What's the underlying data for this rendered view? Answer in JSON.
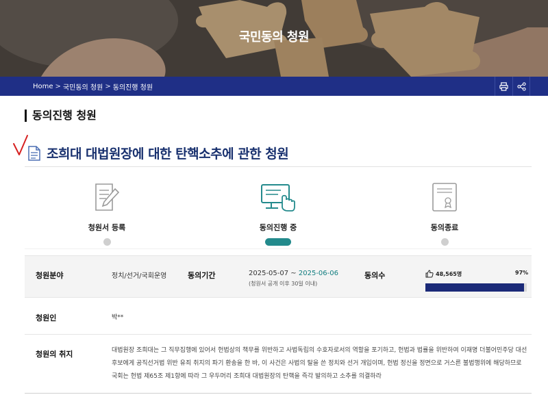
{
  "header": {
    "title": "국민동의 청원"
  },
  "breadcrumb": {
    "home": "Home",
    "level1": "국민동의 청원",
    "level2": "동의진행 청원",
    "separator": ">"
  },
  "section": {
    "title": "동의진행 청원"
  },
  "petition": {
    "title": "조희대 대법원장에 대한 탄핵소추에 관한 청원"
  },
  "steps": [
    {
      "label": "청원서 등록",
      "icon": "document-pen-icon",
      "state": "done"
    },
    {
      "label": "동의진행 중",
      "icon": "computer-touch-icon",
      "state": "current"
    },
    {
      "label": "동의종료",
      "icon": "certificate-icon",
      "state": "upcoming"
    }
  ],
  "details": {
    "field_label": "청원분야",
    "field_value": "정치/선거/국회운영",
    "period_label": "동의기간",
    "period_start": "2025-05-07 ~",
    "period_end": "2025-06-06",
    "period_note": "(청원서 공개 이후 30일 이내)",
    "count_label": "동의수",
    "count_value": "48,565명",
    "percent_text": "97%",
    "percent_value": 97,
    "petitioner_label": "청원인",
    "petitioner_value": "박**",
    "purpose_label": "청원의 취지",
    "purpose_text": "대법원장 조희대는 그 직무집행에 있어서 헌법상의 책무를 위반하고 사법독립의 수호자로서의 역할을 포기하고, 헌법과 법률을 위반하여 이재명 더불어민주당 대선 후보에게 공직선거법 위반 유죄 취지의 파기 환송을 한 바, 이 사건은 사법의 탈을 쓴 정치와 선거 개입이며, 헌법 정신을 정면으로 거스른 불법행위에 해당하므로 국회는 헌법 제65조 제1항에 따라 그 우두머리 조희대 대법원장의 탄핵을 즉각 발의하고 소추를 의결하라"
  },
  "colors": {
    "nav": "#1f2f86",
    "accent_teal": "#238a8c",
    "title_navy": "#18306e",
    "bar_fill": "#1b2a78",
    "check_red": "#d62020"
  }
}
